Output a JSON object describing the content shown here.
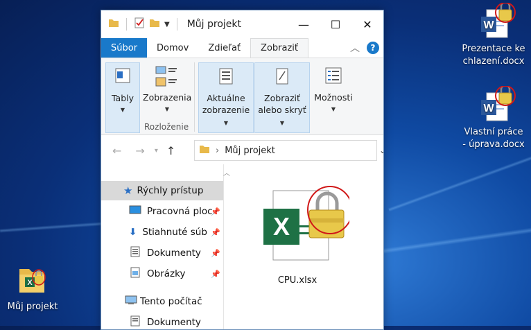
{
  "desktop": {
    "icons": [
      {
        "label_line1": "Prezentace ke",
        "label_line2": "chlazení.docx"
      },
      {
        "label_line1": "Vlastní práce",
        "label_line2": "- úprava.docx"
      },
      {
        "label_line1": "Můj projekt",
        "label_line2": ""
      }
    ]
  },
  "window": {
    "title": "Můj projekt",
    "tabs": [
      "Súbor",
      "Domov",
      "Zdieľať",
      "Zobraziť"
    ],
    "ribbon": {
      "panes": "Tably",
      "layouts": "Zobrazenia",
      "layout_group": "Rozloženie",
      "current_view_l1": "Aktuálne",
      "current_view_l2": "zobrazenie",
      "show_hide_l1": "Zobraziť",
      "show_hide_l2": "alebo skryť",
      "options": "Možnosti"
    },
    "address": {
      "path": "Můj projekt"
    },
    "nav": [
      {
        "label": "Rýchly prístup"
      },
      {
        "label": "Pracovná ploc"
      },
      {
        "label": "Stiahnuté súb"
      },
      {
        "label": "Dokumenty"
      },
      {
        "label": "Obrázky"
      },
      {
        "label": "Tento počítač"
      },
      {
        "label": "Dokumenty"
      }
    ],
    "files": [
      {
        "name": "CPU.xlsx"
      }
    ]
  },
  "colors": {
    "accent": "#1979ca",
    "excel_green": "#1e7145",
    "word_blue": "#2b579a",
    "lock_gold": "#e8c84a",
    "highlight_circle": "#d01818"
  }
}
